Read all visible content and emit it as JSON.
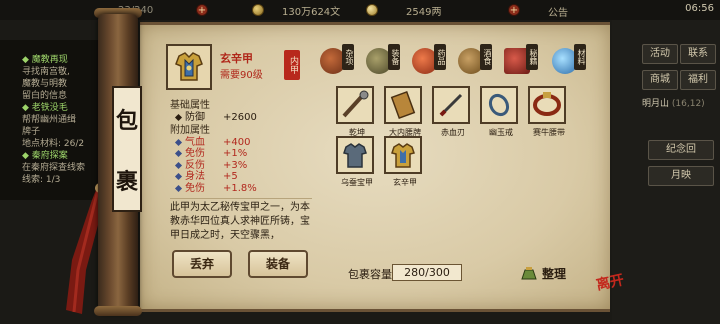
{
  "hud": {
    "tili": "23/240",
    "tongqian": "130万624文",
    "yuanbao": "2549两",
    "announce": "公告",
    "time": "06:56",
    "right_buttons": [
      "活动",
      "联系",
      "商城",
      "福利",
      "明月山"
    ],
    "map_coord": "(16,12)",
    "sub_buttons": [
      "纪念回",
      "月映"
    ]
  },
  "quests": [
    {
      "title": "魔教再现",
      "lines": [
        "寻找南宫敬,",
        "魔教与明教",
        "留白的信息"
      ]
    },
    {
      "title": "老铁没毛",
      "lines": [
        "帮帮幽州通缉",
        "牌子",
        "地点材料: 26/2"
      ]
    },
    {
      "title": "秦府探案",
      "lines": [
        "在秦府探查线索",
        "线索: 1/3"
      ]
    }
  ],
  "side_label": [
    "包",
    "裹"
  ],
  "item": {
    "name": "玄辛甲",
    "requirement": "需要90级",
    "seal": "内甲",
    "base_title": "基础属性",
    "base": [
      {
        "k": "防御",
        "v": "+2600"
      }
    ],
    "extra_title": "附加属性",
    "extra": [
      {
        "k": "气血",
        "v": "+400"
      },
      {
        "k": "免伤",
        "v": "+1%"
      },
      {
        "k": "反伤",
        "v": "+3%"
      },
      {
        "k": "身法",
        "v": "+5"
      },
      {
        "k": "免伤",
        "v": "+1.8%"
      }
    ],
    "desc": "此甲为太乙秘传宝甲之一，为本教赤华四位真人求神匠所铸，宝甲日成之时，天空骤黑，"
  },
  "buttons": {
    "drop": "丢弃",
    "equip": "装备",
    "sort": "整理"
  },
  "categories": [
    {
      "name": "杂项",
      "icon": "sundries-bag-icon",
      "color": "#8a4a2a"
    },
    {
      "name": "装备",
      "icon": "equipment-armor-icon",
      "color": "#6a6a44"
    },
    {
      "name": "药品",
      "icon": "medicine-icon",
      "color": "#c24a2a"
    },
    {
      "name": "酒食",
      "icon": "wine-food-icon",
      "color": "#8a6a30"
    },
    {
      "name": "秘籍",
      "icon": "secret-book-icon",
      "color": "#9a3a3a"
    },
    {
      "name": "材料",
      "icon": "material-crystal-icon",
      "color": "#4a8ac0"
    }
  ],
  "inventory": [
    {
      "name": "乾坤",
      "icon": "staff-icon"
    },
    {
      "name": "大内腰牌",
      "icon": "token-plaque-icon"
    },
    {
      "name": "赤血刃",
      "icon": "blade-icon"
    },
    {
      "name": "幽玉戒",
      "icon": "ring-icon"
    },
    {
      "name": "赛牛腰带",
      "icon": "belt-icon"
    },
    {
      "name": "乌蚕宝甲",
      "icon": "armor-icon"
    },
    {
      "name": "玄辛甲",
      "icon": "golden-armor-icon"
    }
  ],
  "capacity_label": "包裹容量",
  "capacity_value": "280/300",
  "close_label": "离开"
}
